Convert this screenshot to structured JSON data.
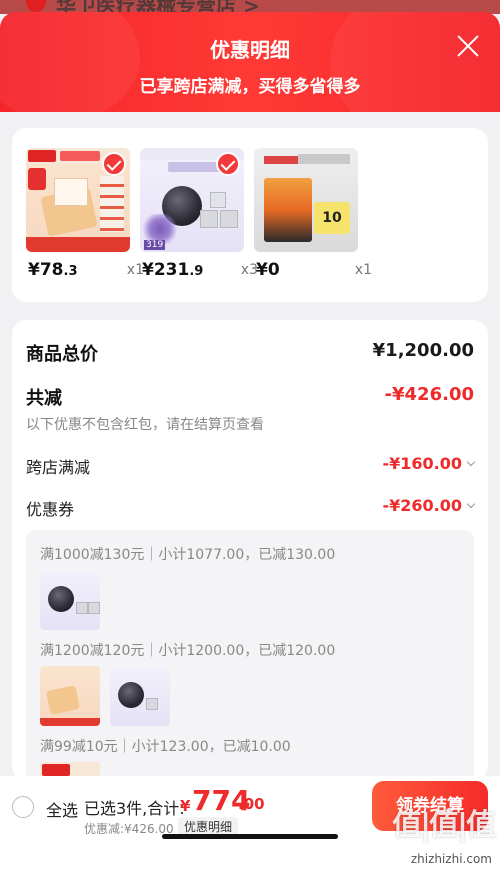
{
  "underlay": {
    "shop_title": "华卫医疗器械专营店 >"
  },
  "header": {
    "title": "优惠明细",
    "subtitle": "已享跨店满减，买得多省得多"
  },
  "products": [
    {
      "price_int": "¥78",
      "price_dec": ".3",
      "qty": "x1"
    },
    {
      "price_int": "¥231",
      "price_dec": ".9",
      "qty": "x3"
    },
    {
      "price_int": "¥0",
      "price_dec": "",
      "qty": "x1"
    }
  ],
  "product_art": {
    "t3_badge": "10",
    "t2_badge": "319"
  },
  "summary": {
    "total_label": "商品总价",
    "total_value": "¥1,200.00",
    "reduce_label": "共减",
    "reduce_value": "-¥426.00",
    "reduce_note": "以下优惠不包含红包，请在结算页查看",
    "cross_label": "跨店满减",
    "cross_value": "-¥160.00",
    "coupon_label": "优惠券",
    "coupon_value": "-¥260.00"
  },
  "tiers": [
    "满1000减130元｜小计1077.00，已减130.00",
    "满1200减120元｜小计1200.00，已减120.00",
    "满99减10元｜小计123.00，已减10.00"
  ],
  "bottom": {
    "select_all": "全选",
    "selected": "已选3件,合计:",
    "total_symbol": "¥",
    "total_int": "774",
    "total_dec": ".00",
    "saved": "优惠减:¥426.00",
    "detail_pill": "优惠明细",
    "checkout": "领券结算"
  },
  "watermark": {
    "logo_text": "值|值|值",
    "url": "zhizhizhi.com"
  },
  "colors": {
    "accent_red": "#ee2a2a",
    "header_red": "#f5232a"
  }
}
